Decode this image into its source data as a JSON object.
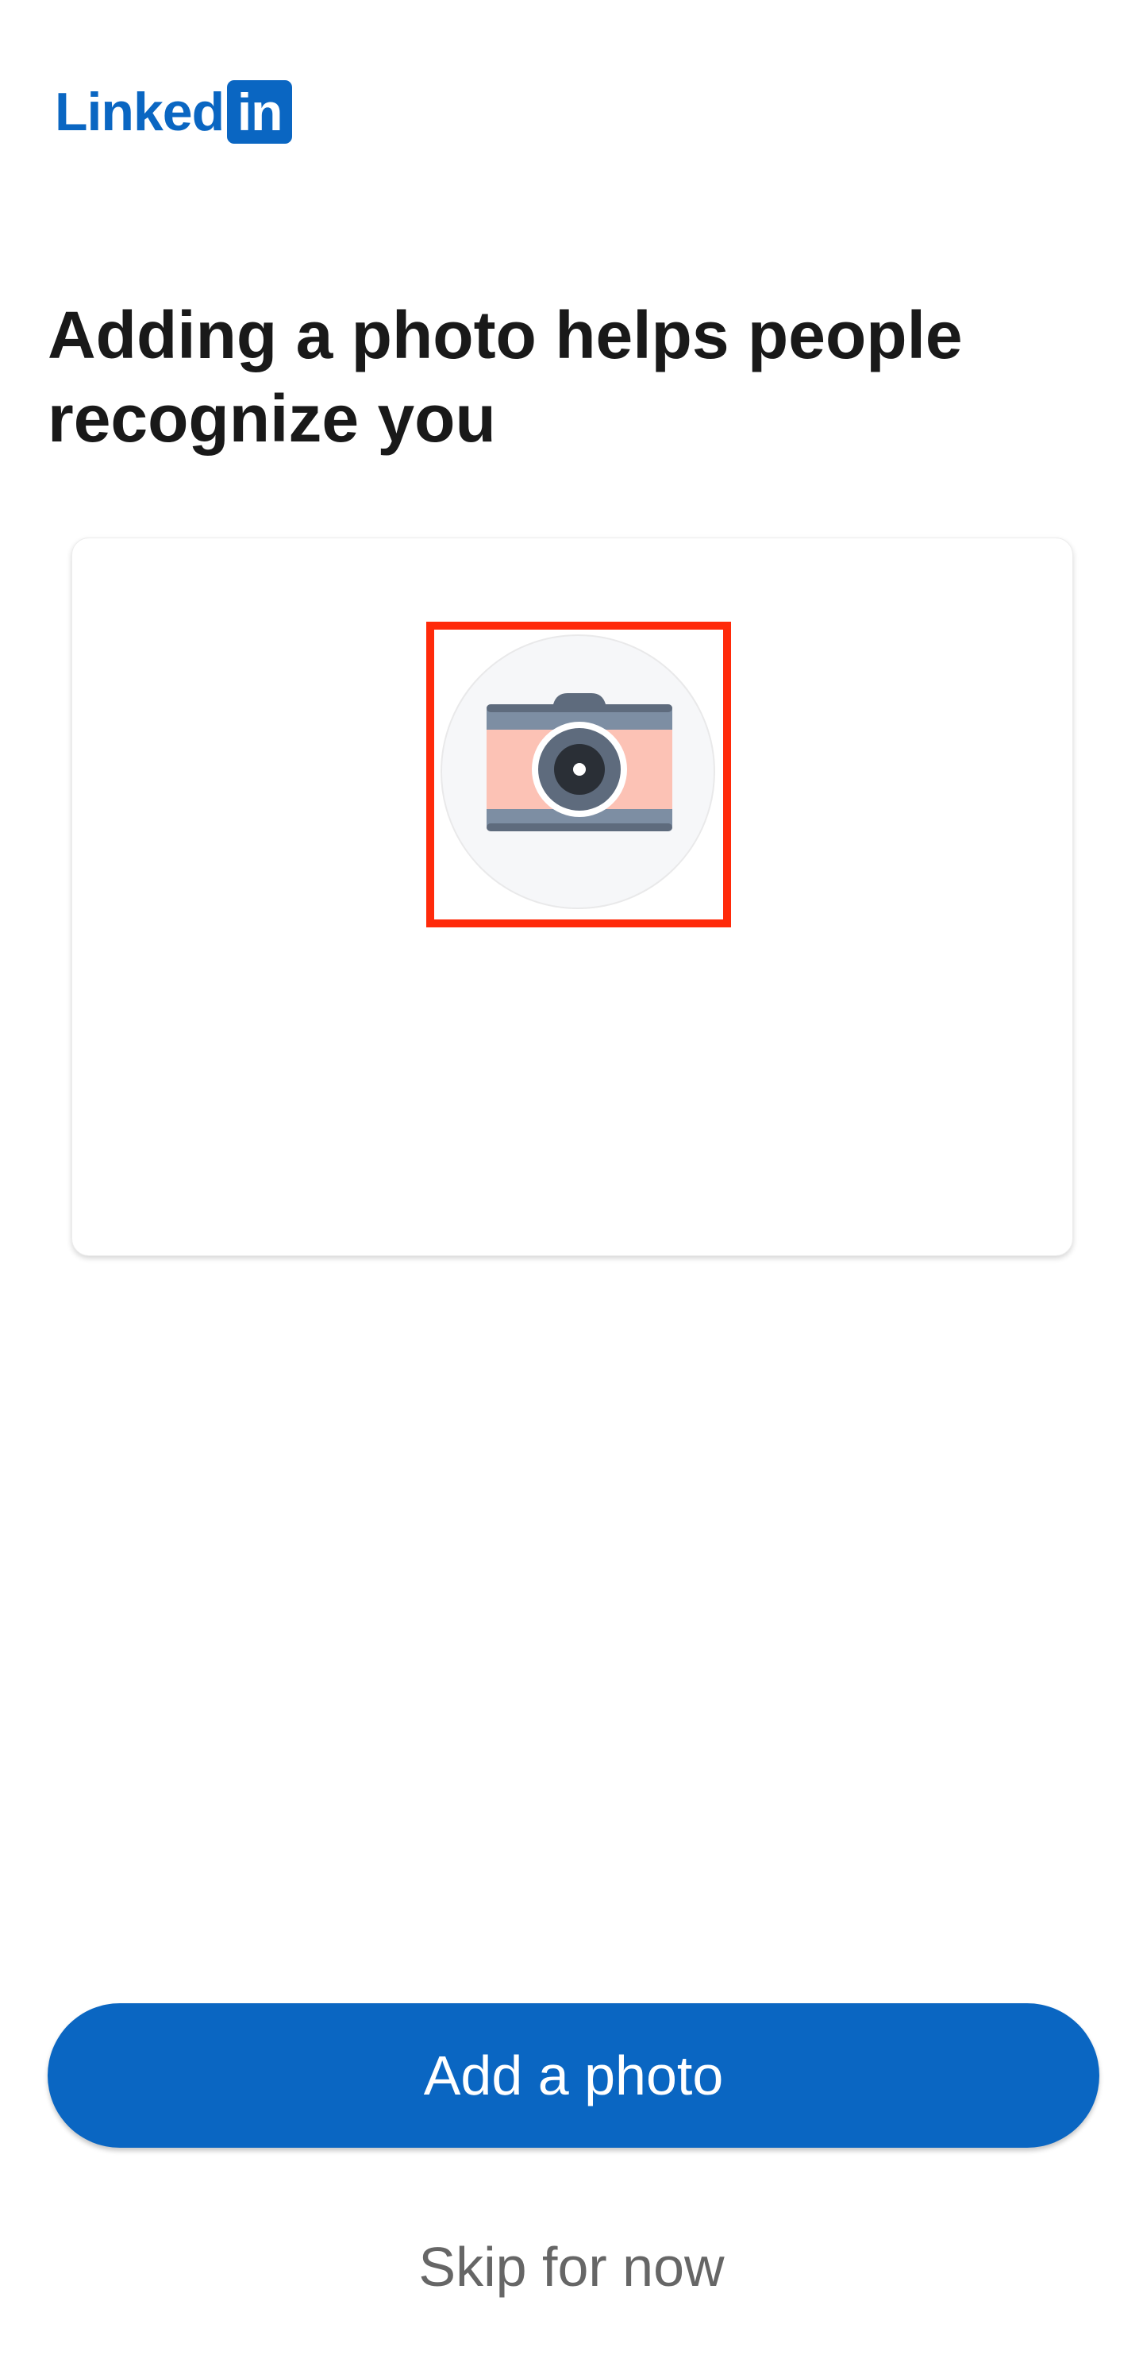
{
  "app": {
    "logo_text": "Linked",
    "logo_box_text": "in",
    "brand_color": "#0a66c2"
  },
  "onboarding": {
    "headline": "Adding a photo helps people recognize you",
    "photo_placeholder_icon": "camera-icon",
    "highlight_color": "#ff2a0a"
  },
  "actions": {
    "add_photo_label": "Add a photo",
    "skip_label": "Skip for now"
  }
}
